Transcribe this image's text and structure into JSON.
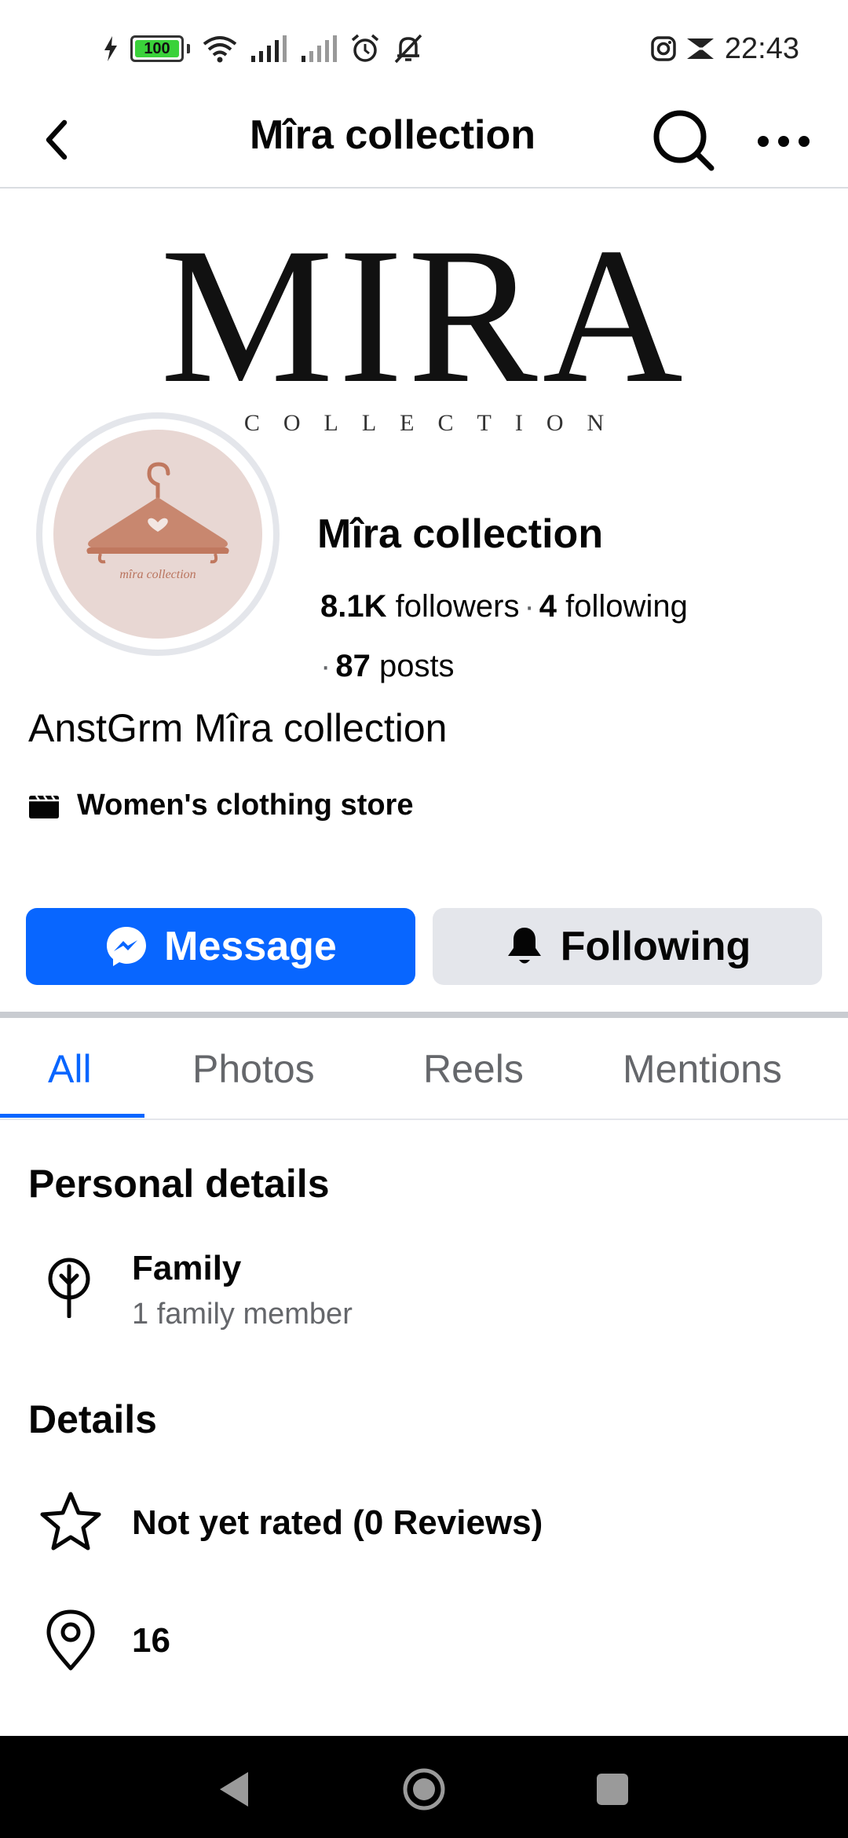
{
  "status_bar": {
    "battery_level": "100",
    "time": "22:43",
    "icons": [
      "charging-icon",
      "battery-icon",
      "wifi-icon",
      "signal-icon",
      "signal-icon",
      "alarm-icon",
      "mute-icon",
      "instagram-icon",
      "notification-icon"
    ]
  },
  "header": {
    "title": "Mîra collection",
    "icons": [
      "back-arrow-icon",
      "search-icon",
      "more-icon"
    ]
  },
  "cover": {
    "logo_text": "MIRA",
    "logo_subtext": "COLLECTION"
  },
  "avatar": {
    "logo_text": "mîra collection"
  },
  "profile": {
    "name": "Mîra collection",
    "followers_count": "8.1K",
    "followers_label": "followers",
    "following_count": "4",
    "following_label": "following",
    "posts_count": "87",
    "posts_label": "posts",
    "bio": "AnstGrm Mîra collection",
    "category": "Women's clothing store"
  },
  "actions": {
    "message_label": "Message",
    "following_label": "Following"
  },
  "tabs": [
    {
      "label": "All",
      "active": true
    },
    {
      "label": "Photos",
      "active": false
    },
    {
      "label": "Reels",
      "active": false
    },
    {
      "label": "Mentions",
      "active": false
    }
  ],
  "personal_details": {
    "title": "Personal details",
    "family_title": "Family",
    "family_sub": "1 family member"
  },
  "details": {
    "title": "Details",
    "rating": "Not yet rated (0 Reviews)",
    "location": "16"
  },
  "colors": {
    "primary": "#0866ff",
    "secondary_button": "#e4e6eb",
    "text_secondary": "#65676b"
  }
}
